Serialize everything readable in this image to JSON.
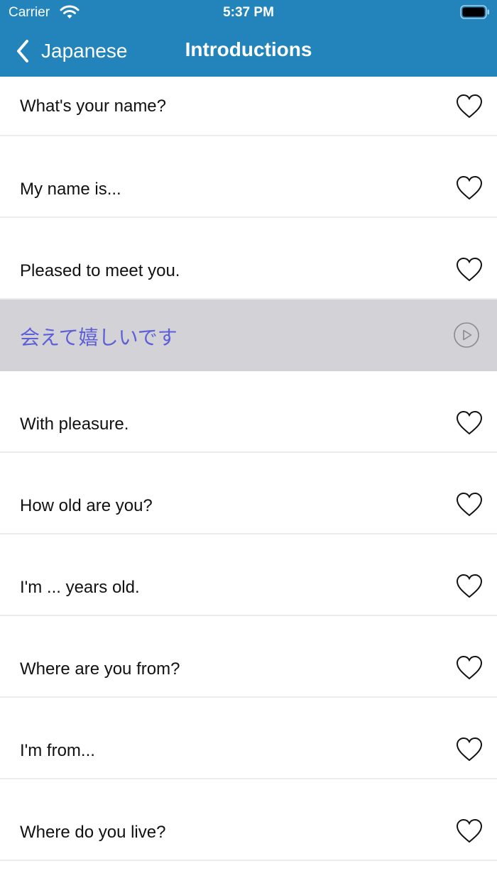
{
  "status_bar": {
    "carrier": "Carrier",
    "time": "5:37 PM"
  },
  "nav": {
    "back_label": "Japanese",
    "title": "Introductions"
  },
  "phrases": [
    "What's your name?",
    "My name is...",
    "Pleased to meet you.",
    "With pleasure.",
    "How old are you?",
    "I'm ... years old.",
    "Where are you from?",
    "I'm from...",
    "Where do you live?"
  ],
  "expanded_translation": "会えて嬉しいです",
  "colors": {
    "header": "#2284bb",
    "translation_text": "#5d5fd8",
    "translation_bg": "#d2d2d7"
  },
  "icons": {
    "favorite": "heart-icon",
    "play": "play-icon",
    "back": "chevron-left-icon"
  }
}
